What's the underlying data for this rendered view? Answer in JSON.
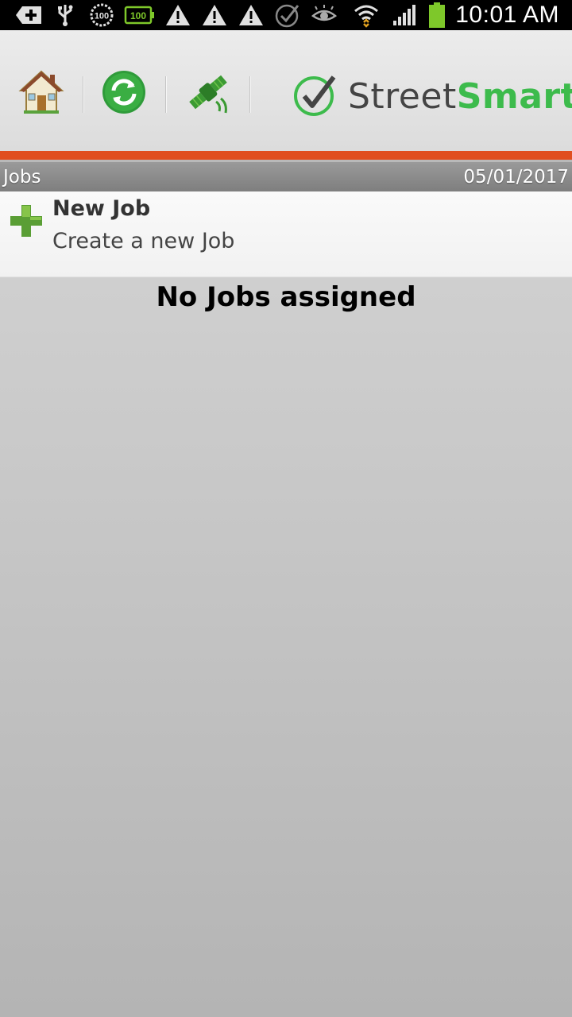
{
  "status_bar": {
    "time": "10:01 AM",
    "left_icons": [
      "plus-circle-icon",
      "usb-icon",
      "badge-100-icon",
      "battery-100-icon",
      "warning-icon",
      "warning-icon",
      "warning-icon",
      "check-circle-icon",
      "eye-icon"
    ],
    "badge_circle_text": "100",
    "badge_battery_text": "100",
    "battery_color": "#7ec82a"
  },
  "toolbar": {
    "buttons": [
      "home-icon",
      "sync-icon",
      "satellite-icon"
    ],
    "brand_part1": "Street",
    "brand_part2": "Smart",
    "brand_color": "#3dbb4c",
    "accent_color": "#e04e1f"
  },
  "list_header": {
    "title": "Jobs",
    "date": "05/01/2017"
  },
  "new_job": {
    "title": "New Job",
    "subtitle": "Create a new Job"
  },
  "empty_message": "No Jobs assigned"
}
